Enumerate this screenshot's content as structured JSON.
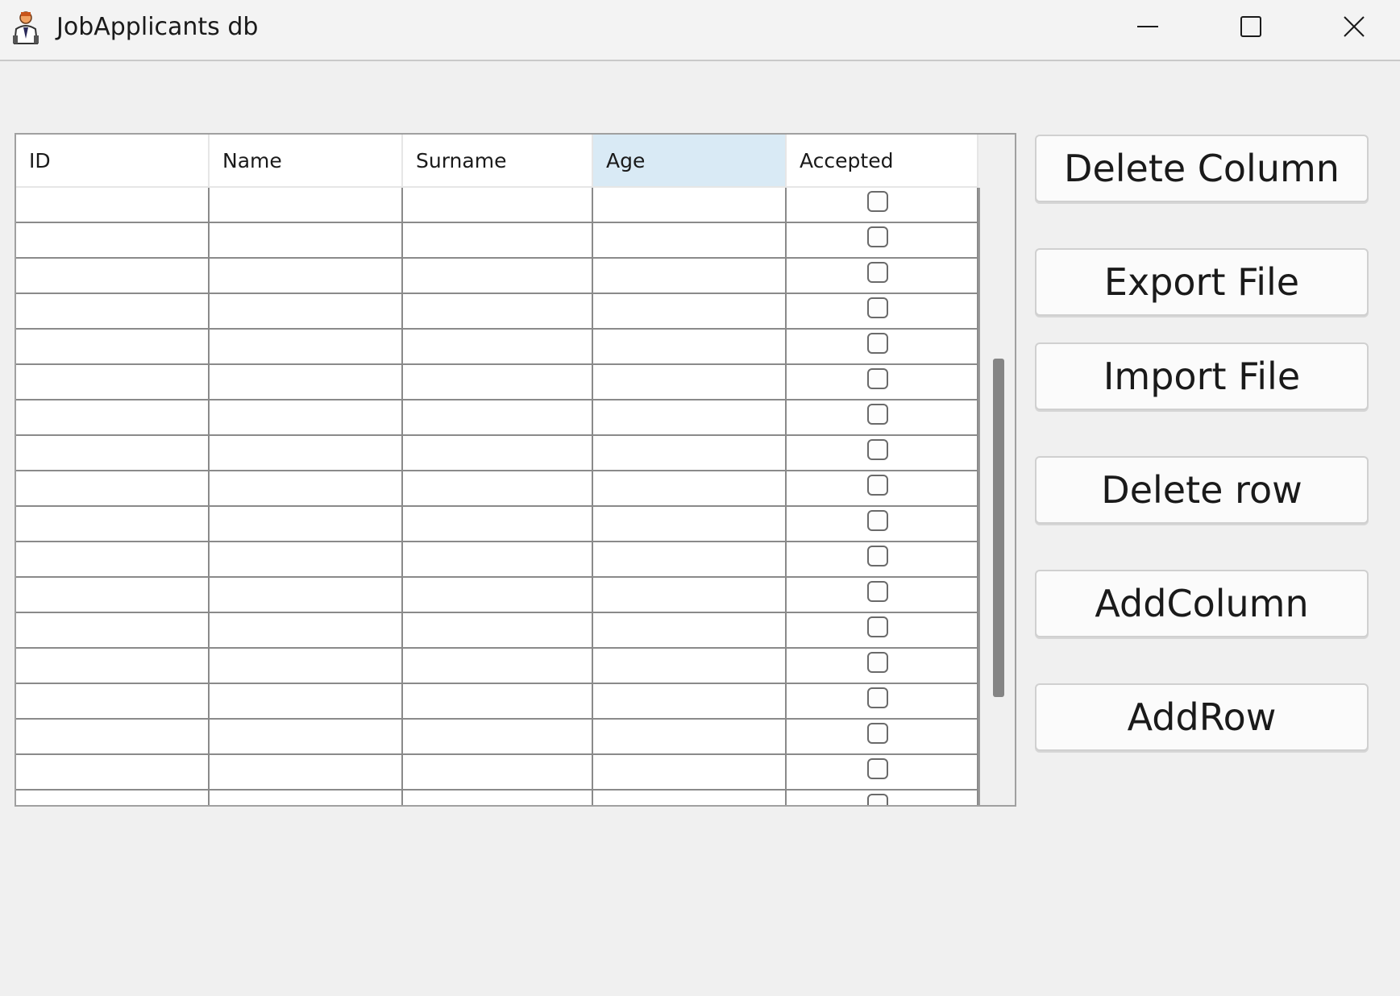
{
  "window": {
    "title": "JobApplicants db",
    "icon": "person-avatar-icon"
  },
  "table": {
    "columns": [
      "ID",
      "Name",
      "Surname",
      "Age",
      "Accepted"
    ],
    "selected_column": "Age",
    "visible_row_count": 18,
    "rows": [
      {
        "ID": "",
        "Name": "",
        "Surname": "",
        "Age": "",
        "Accepted": false
      },
      {
        "ID": "",
        "Name": "",
        "Surname": "",
        "Age": "",
        "Accepted": false
      },
      {
        "ID": "",
        "Name": "",
        "Surname": "",
        "Age": "",
        "Accepted": false
      },
      {
        "ID": "",
        "Name": "",
        "Surname": "",
        "Age": "",
        "Accepted": false
      },
      {
        "ID": "",
        "Name": "",
        "Surname": "",
        "Age": "",
        "Accepted": false
      },
      {
        "ID": "",
        "Name": "",
        "Surname": "",
        "Age": "",
        "Accepted": false
      },
      {
        "ID": "",
        "Name": "",
        "Surname": "",
        "Age": "",
        "Accepted": false
      },
      {
        "ID": "",
        "Name": "",
        "Surname": "",
        "Age": "",
        "Accepted": false
      },
      {
        "ID": "",
        "Name": "",
        "Surname": "",
        "Age": "",
        "Accepted": false
      },
      {
        "ID": "",
        "Name": "",
        "Surname": "",
        "Age": "",
        "Accepted": false
      },
      {
        "ID": "",
        "Name": "",
        "Surname": "",
        "Age": "",
        "Accepted": false
      },
      {
        "ID": "",
        "Name": "",
        "Surname": "",
        "Age": "",
        "Accepted": false
      },
      {
        "ID": "",
        "Name": "",
        "Surname": "",
        "Age": "",
        "Accepted": false
      },
      {
        "ID": "",
        "Name": "",
        "Surname": "",
        "Age": "",
        "Accepted": false
      },
      {
        "ID": "",
        "Name": "",
        "Surname": "",
        "Age": "",
        "Accepted": false
      },
      {
        "ID": "",
        "Name": "",
        "Surname": "",
        "Age": "",
        "Accepted": false
      },
      {
        "ID": "",
        "Name": "",
        "Surname": "",
        "Age": "",
        "Accepted": false
      },
      {
        "ID": "",
        "Name": "",
        "Surname": "",
        "Age": "",
        "Accepted": false
      }
    ]
  },
  "buttons": {
    "delete_column": "Delete Column",
    "export_file": "Export File",
    "import_file": "Import File",
    "delete_row": "Delete row",
    "add_column": "AddColumn",
    "add_row": "AddRow"
  },
  "colors": {
    "selected_header": "#d9eaf5",
    "window_bg": "#f0f0f0",
    "scroll_thumb": "#858585"
  }
}
